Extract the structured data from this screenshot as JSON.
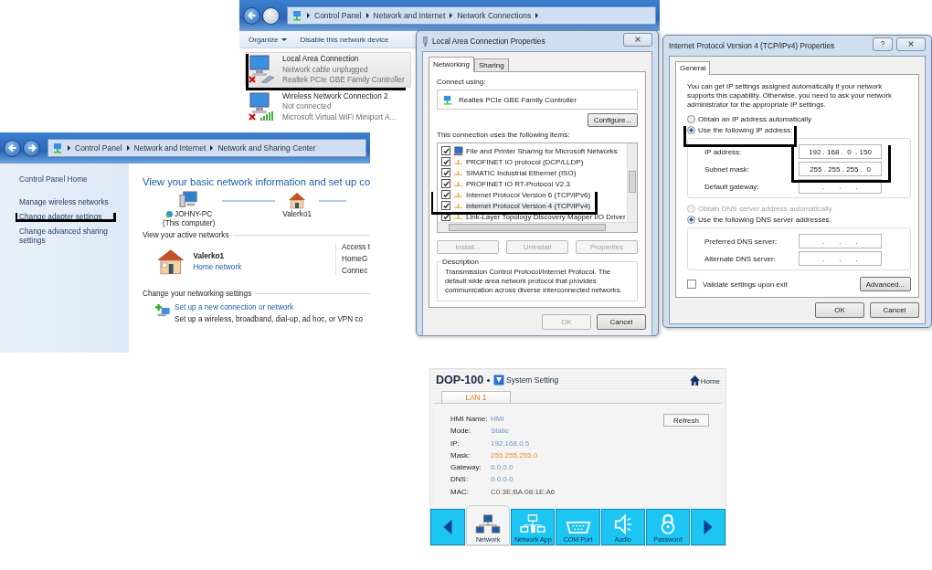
{
  "network_connections": {
    "breadcrumb": [
      "Control Panel",
      "Network and Internet",
      "Network Connections"
    ],
    "toolbar": [
      {
        "label": "Organize",
        "has_menu": true
      },
      {
        "label": "Disable this network device",
        "has_menu": false
      }
    ],
    "connections": [
      {
        "name": "Local Area Connection",
        "status": "Network cable unplugged",
        "adapter": "Realtek PCIe GBE Family Controller",
        "kind": "wired",
        "connected": false,
        "selected": true
      },
      {
        "name": "Wireless Network Connection 2",
        "status": "Not connected",
        "adapter": "Microsoft Virtual WiFi Miniport A...",
        "kind": "wireless",
        "connected": false,
        "selected": false
      }
    ]
  },
  "sharing_center": {
    "breadcrumb": [
      "Control Panel",
      "Network and Internet",
      "Network and Sharing Center"
    ],
    "sidebar": [
      {
        "label": "Control Panel Home",
        "kind": "home"
      },
      {
        "label": "Manage wireless networks",
        "kind": "link"
      },
      {
        "label": "Change adapter settings",
        "kind": "link"
      },
      {
        "label": "Change advanced sharing settings",
        "kind": "link"
      }
    ],
    "heading": "View your basic network information and set up co",
    "computer_name": "JOHNY-PC",
    "computer_note": "(This computer)",
    "network_name": "Valerko1",
    "active_networks_label": "View your active networks",
    "active_network": {
      "name": "Valerko1",
      "type": "Home network"
    },
    "access_labels": [
      "Access t",
      "HomeG",
      "Connec"
    ],
    "change_settings_label": "Change your networking settings",
    "task": {
      "link": "Set up a new connection or network",
      "description": "Set up a wireless, broadband, dial-up, ad hoc, or VPN co"
    }
  },
  "lan_properties": {
    "title": "Local Area Connection Properties",
    "tabs": [
      {
        "label": "Networking",
        "selected": true
      },
      {
        "label": "Sharing",
        "selected": false
      }
    ],
    "connect_using_label": "Connect using:",
    "adapter": "Realtek PCIe GBE Family Controller",
    "configure_button": "Configure...",
    "items_label": "This connection uses the following items:",
    "items": [
      {
        "label": "File and Printer Sharing for Microsoft Networks",
        "kind": "service",
        "checked": true,
        "selected": false
      },
      {
        "label": "PROFINET IO protocol (DCP/LLDP)",
        "kind": "protocol",
        "checked": true,
        "selected": false
      },
      {
        "label": "SIMATIC Industrial Ethernet (ISO)",
        "kind": "protocol",
        "checked": true,
        "selected": false
      },
      {
        "label": "PROFINET IO RT-Protocol V2.3",
        "kind": "protocol",
        "checked": true,
        "selected": false
      },
      {
        "label": "Internet Protocol Version 6 (TCP/IPv6)",
        "kind": "protocol",
        "checked": true,
        "selected": false
      },
      {
        "label": "Internet Protocol Version 4 (TCP/IPv4)",
        "kind": "protocol",
        "checked": true,
        "selected": true
      },
      {
        "label": "Link-Layer Topology Discovery Mapper I/O Driver",
        "kind": "protocol",
        "checked": true,
        "selected": false
      }
    ],
    "item_buttons": [
      {
        "label": "Install...",
        "disabled": true
      },
      {
        "label": "Uninstall",
        "disabled": true
      },
      {
        "label": "Properties",
        "disabled": true
      }
    ],
    "description_label": "Description",
    "description": "Transmission Control Protocol/Internet Protocol. The default wide area network protocol that provides communication across diverse interconnected networks.",
    "buttons": [
      {
        "label": "OK",
        "disabled": true
      },
      {
        "label": "Cancel",
        "disabled": false
      }
    ]
  },
  "ipv4_properties": {
    "title": "Internet Protocol Version 4 (TCP/IPv4) Properties",
    "tab": "General",
    "intro": "You can get IP settings assigned automatically if your network supports this capability. Otherwise, you need to ask your network administrator for the appropriate IP settings.",
    "ip_options": [
      {
        "label": "Obtain an IP address automatically",
        "selected": false,
        "disabled": false
      },
      {
        "label": "Use the following IP address:",
        "selected": true,
        "disabled": false
      }
    ],
    "ip_fields": [
      {
        "label": "IP address:",
        "value": "192 . 168 .  0  . 150"
      },
      {
        "label": "Subnet mask:",
        "value": "255 . 255 . 255 .  0"
      },
      {
        "label": "Default gateway:",
        "value": ".       .       ."
      }
    ],
    "dns_options": [
      {
        "label": "Obtain DNS server address automatically",
        "selected": false,
        "disabled": true
      },
      {
        "label": "Use the following DNS server addresses:",
        "selected": true,
        "disabled": false
      }
    ],
    "dns_fields": [
      {
        "label": "Preferred DNS server:",
        "value": ".       .       ."
      },
      {
        "label": "Alternate DNS server:",
        "value": ".       .       ."
      }
    ],
    "validate": {
      "label": "Validate settings upon exit",
      "checked": false
    },
    "advanced_button": "Advanced...",
    "buttons": [
      {
        "label": "OK"
      },
      {
        "label": "Cancel"
      }
    ]
  },
  "hmi": {
    "brand": "DOP-100",
    "section": "System Setting",
    "home": "Home",
    "tab": "LAN 1",
    "fields": [
      {
        "label": "HMI Name:",
        "value": "HMI",
        "kind": "normal"
      },
      {
        "label": "Mode:",
        "value": "Static",
        "kind": "normal"
      },
      {
        "label": "IP:",
        "value": "192.168.0.5",
        "kind": "normal"
      },
      {
        "label": "Mask:",
        "value": "255.255.255.0",
        "kind": "highlight"
      },
      {
        "label": "Gateway:",
        "value": "0.0.0.0",
        "kind": "normal"
      },
      {
        "label": "DNS:",
        "value": "0.0.0.0",
        "kind": "normal"
      },
      {
        "label": "MAC:",
        "value": "C0:3E:BA:08:1E:A6",
        "kind": "readonly"
      }
    ],
    "refresh_button": "Refresh",
    "nav": [
      {
        "label": "Network",
        "kind": "network",
        "selected": true
      },
      {
        "label": "Network App",
        "kind": "network_app",
        "selected": false
      },
      {
        "label": "COM Port",
        "kind": "com_port",
        "selected": false
      },
      {
        "label": "Audio",
        "kind": "audio",
        "selected": false
      },
      {
        "label": "Password",
        "kind": "password",
        "selected": false
      }
    ]
  }
}
